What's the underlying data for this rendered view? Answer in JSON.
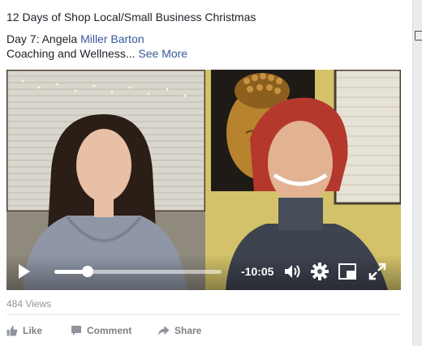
{
  "post": {
    "title": "12 Days of Shop Local/Small Business Christmas",
    "day_prefix": "Day 7: Angela ",
    "person_link": "Miller Barton",
    "desc": "Coaching and Wellness...",
    "see_more": "See More"
  },
  "video": {
    "time_remaining": "-10:05",
    "progress_fraction": 0.2
  },
  "stats": {
    "views": "484 Views"
  },
  "actions": {
    "like": "Like",
    "comment": "Comment",
    "share": "Share"
  },
  "icons": {
    "play": "play-icon",
    "volume": "volume-icon",
    "settings": "gear-icon",
    "pip": "picture-in-picture-icon",
    "fullscreen": "fullscreen-icon",
    "like": "thumbs-up-icon",
    "comment": "comment-icon",
    "share": "share-arrow-icon"
  },
  "colors": {
    "link": "#365899",
    "muted": "#90949c",
    "action": "#7f7f7f"
  }
}
